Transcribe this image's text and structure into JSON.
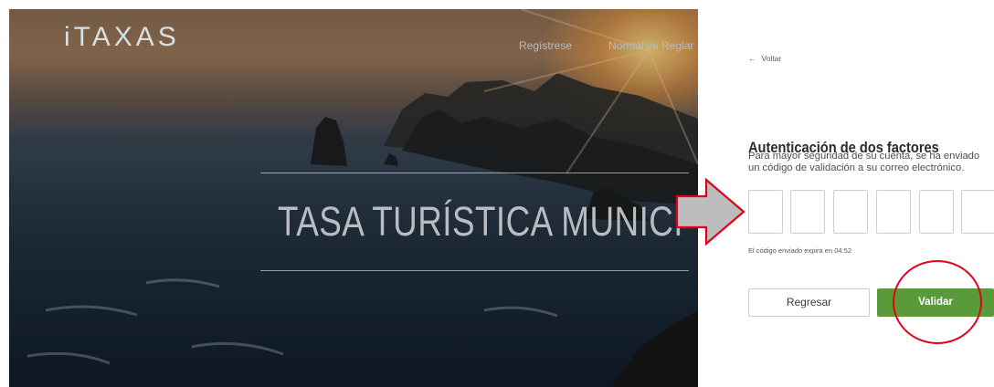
{
  "hero": {
    "logo": "iTAXAS",
    "nav": {
      "register": "Regístrese",
      "normativa": "Normativa Reglar"
    },
    "title": "TASA TURÍSTICA MUNICI"
  },
  "panel": {
    "back": "Voltar",
    "title": "Autenticación de dos factores",
    "desc_line1": "Para mayor seguridad de su cuenta, se ha enviado",
    "desc_line2": "un código de validación a su correo electrónico.",
    "code_boxes": [
      "",
      "",
      "",
      "",
      "",
      ""
    ],
    "expire": "El código enviado expira en 04:52",
    "btn_back": "Regresar",
    "btn_validate": "Validar"
  },
  "colors": {
    "accent_green": "#5a9a3a",
    "annotation_red": "#e3001b"
  },
  "icons": {
    "back": "arrow-left-icon",
    "annotation": "arrow-right-icon"
  }
}
